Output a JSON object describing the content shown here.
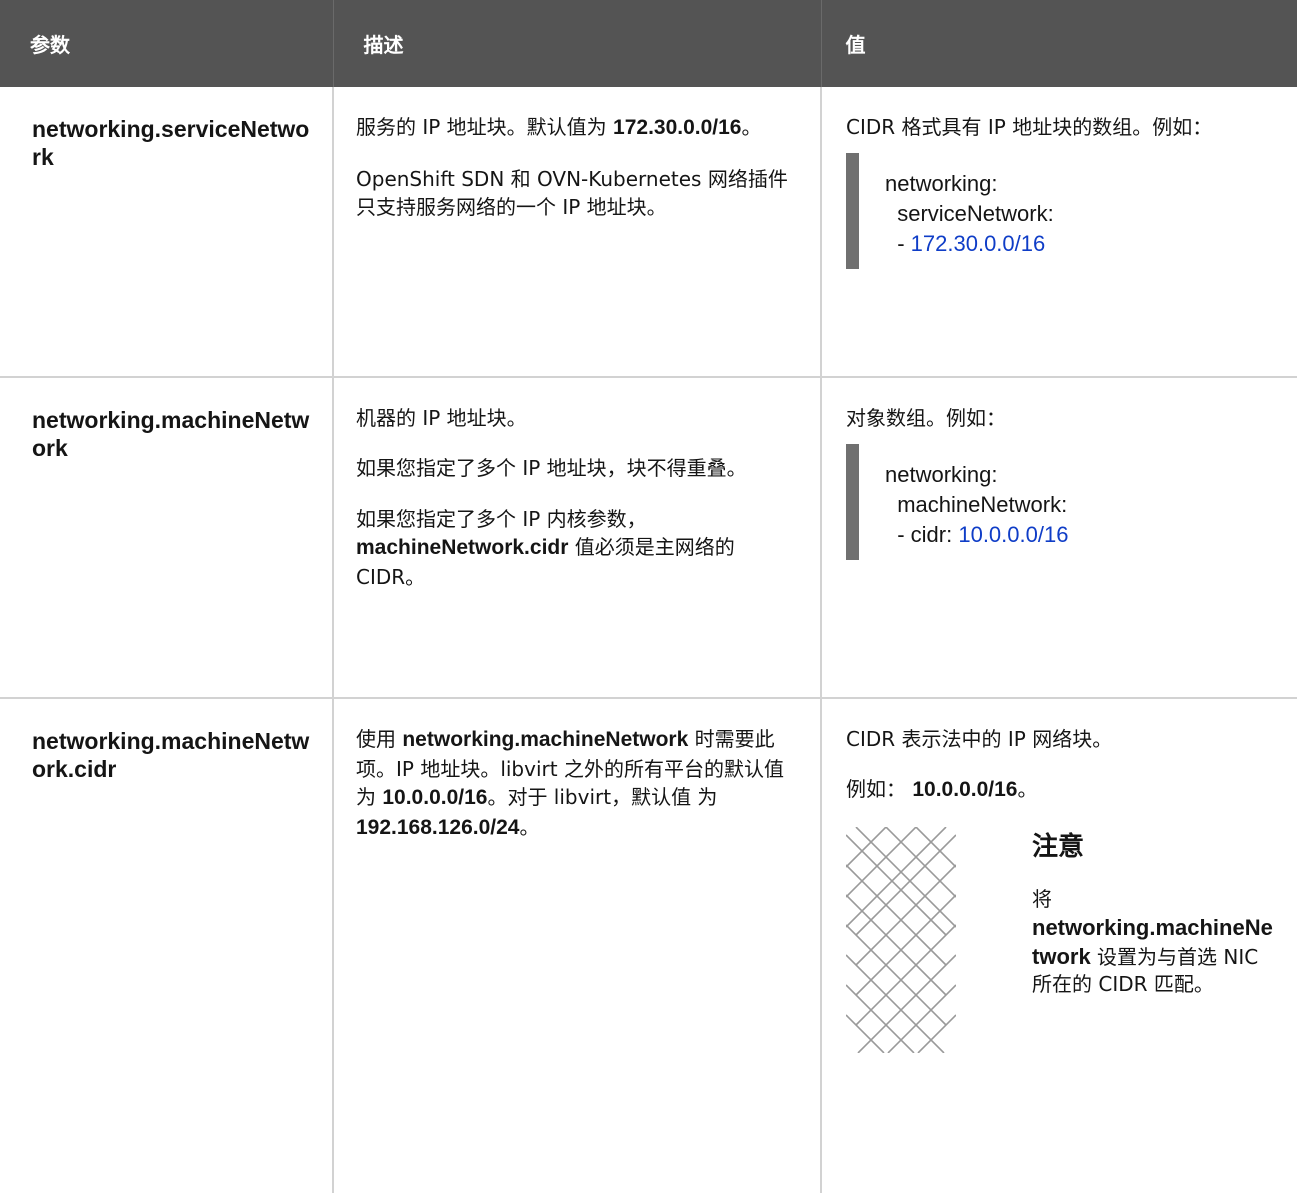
{
  "headers": [
    "参数",
    "描述",
    "值"
  ],
  "rows": [
    {
      "param": "networking.serviceNetwork",
      "desc": [
        {
          "pre": "服务的 IP 地址块。默认值为 ",
          "bold": "172.30.0.0/16",
          "post": "。"
        },
        {
          "pre": "OpenShift SDN 和 OVN-Kubernetes 网络插件只支持服务网络的一个 IP 地址块。",
          "bold": "",
          "post": ""
        }
      ],
      "value_text": "CIDR 格式具有 IP 地址块的数组。例如：",
      "code": {
        "line1": "networking:",
        "line2": "  serviceNetwork:",
        "line3_prefix": "  - ",
        "line3_literal": "172.30.0.0/16"
      }
    },
    {
      "param": "networking.machineNetwork",
      "desc": [
        {
          "pre": "机器的 IP 地址块。",
          "bold": "",
          "post": ""
        },
        {
          "pre": "如果您指定了多个 IP 地址块，块不得重叠。",
          "bold": "",
          "post": ""
        },
        {
          "pre": "如果您指定了多个 IP 内核参数，",
          "bold": "machineNetwork.cidr",
          "post": " 值必须是主网络的 CIDR。"
        }
      ],
      "value_text": "对象数组。例如：",
      "code": {
        "line1": "networking:",
        "line2": "  machineNetwork:",
        "line3_prefix": "  - cidr: ",
        "line3_literal": "10.0.0.0/16"
      }
    },
    {
      "param": "networking.machineNetwork.cidr",
      "desc_parts": [
        {
          "t": "使用 ",
          "b": false
        },
        {
          "t": "networking.machineNetwork",
          "b": true
        },
        {
          "t": " 时需要此项。IP 地址块。libvirt 之外的所有平台的默认值为 ",
          "b": false
        },
        {
          "t": "10.0.0.0/16",
          "b": true
        },
        {
          "t": "。对于 libvirt，默认值 为 ",
          "b": false
        },
        {
          "t": "192.168.126.0/24",
          "b": true
        },
        {
          "t": "。",
          "b": false
        }
      ],
      "value_line1": "CIDR 表示法中的 IP 网络块。",
      "value_line2_pre": "例如：",
      "value_line2_bold": "10.0.0.0/16",
      "value_line2_post": "。",
      "note": {
        "icon": "important-pattern-icon",
        "title": "注意",
        "pre": "将 ",
        "bold": "networking.machineNetwork",
        "post": " 设置为与首选 NIC 所在的 CIDR 匹配。"
      }
    }
  ]
}
